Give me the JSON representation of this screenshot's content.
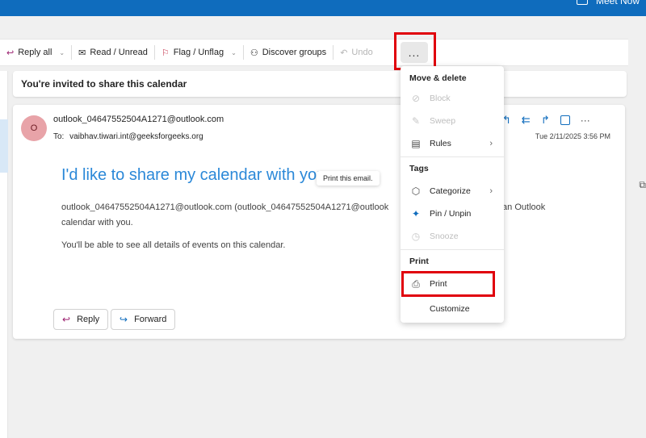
{
  "topbar": {
    "meet_now": "Meet Now"
  },
  "ribbon": {
    "reply_all": "Reply all",
    "read_unread": "Read / Unread",
    "flag_unflag": "Flag / Unflag",
    "discover_groups": "Discover groups",
    "undo": "Undo",
    "more": "..."
  },
  "subject": "You're invited to share this calendar",
  "message": {
    "avatar_initial": "O",
    "sender": "outlook_04647552504A1271@outlook.com",
    "to_label": "To:",
    "to": "vaibhav.tiwari.int@geeksforgeeks.org",
    "date": "Tue 2/11/2025 3:56 PM",
    "headline": "I'd like to share my calendar with you",
    "body_line1": "outlook_04647552504A1271@outlook.com (outlook_04647552504A1271@outlook",
    "body_line1_tail": "re an Outlook",
    "body_line2": "calendar with you.",
    "body_line3": "You'll be able to see all details of events on this calendar.",
    "reply": "Reply",
    "forward": "Forward"
  },
  "tooltip": "Print this email.",
  "menu": {
    "move_delete": "Move & delete",
    "block": "Block",
    "sweep": "Sweep",
    "rules": "Rules",
    "tags": "Tags",
    "categorize": "Categorize",
    "pin_unpin": "Pin / Unpin",
    "snooze": "Snooze",
    "print_header": "Print",
    "print": "Print",
    "customize": "Customize"
  },
  "colors": {
    "accent": "#0f6cbd",
    "highlight": "#e0000b",
    "avatar": "#e8a3a8"
  },
  "icons": [
    "reply-all-icon",
    "envelope-icon",
    "flag-icon",
    "people-icon",
    "undo-icon",
    "block-icon",
    "broom-icon",
    "rules-icon",
    "tag-icon",
    "pin-icon",
    "clock-icon",
    "printer-icon"
  ]
}
